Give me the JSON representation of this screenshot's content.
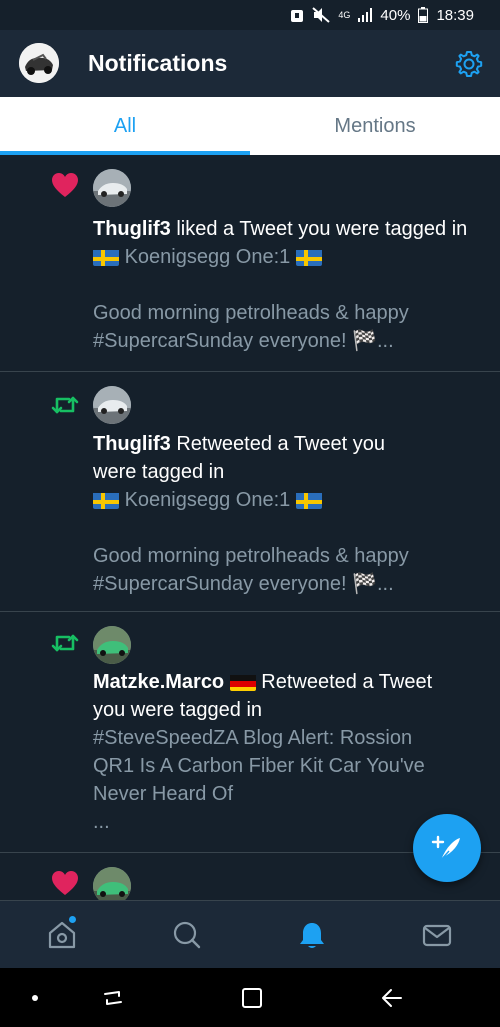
{
  "status_bar": {
    "network": "4G",
    "battery": "40%",
    "time": "18:39"
  },
  "header": {
    "title": "Notifications"
  },
  "tabs": [
    {
      "label": "All",
      "active": true
    },
    {
      "label": "Mentions",
      "active": false
    }
  ],
  "notifications": [
    {
      "type": "like",
      "user": "Thuglif3",
      "action": "liked a Tweet you were tagged in",
      "subtitle": "Koenigsegg One:1",
      "text_line1": "Good morning petrolheads & happy",
      "text_line2": "#SupercarSunday everyone! 🏁..."
    },
    {
      "type": "retweet",
      "user": "Thuglif3",
      "action": "Retweeted a Tweet you",
      "action_line2": "were tagged in",
      "subtitle": "Koenigsegg One:1",
      "text_line1": "Good morning petrolheads & happy",
      "text_line2": "#SupercarSunday everyone! 🏁..."
    },
    {
      "type": "retweet",
      "user": "Matzke.Marco",
      "action": "Retweeted a Tweet",
      "action_line2": "you were tagged in",
      "text_line1": "#SteveSpeedZA Blog Alert: Rossion",
      "text_line2": "QR1 Is A Carbon Fiber Kit Car You've",
      "text_line3": "Never Heard Of",
      "text_line4": "..."
    },
    {
      "type": "like"
    }
  ],
  "bottom_nav": [
    "home-icon",
    "search-icon",
    "bell-icon",
    "mail-icon"
  ],
  "colors": {
    "background": "#15202b",
    "accent": "#1da1f2",
    "like": "#e0245e",
    "retweet": "#17bf63",
    "secondary_text": "#8899a6"
  }
}
